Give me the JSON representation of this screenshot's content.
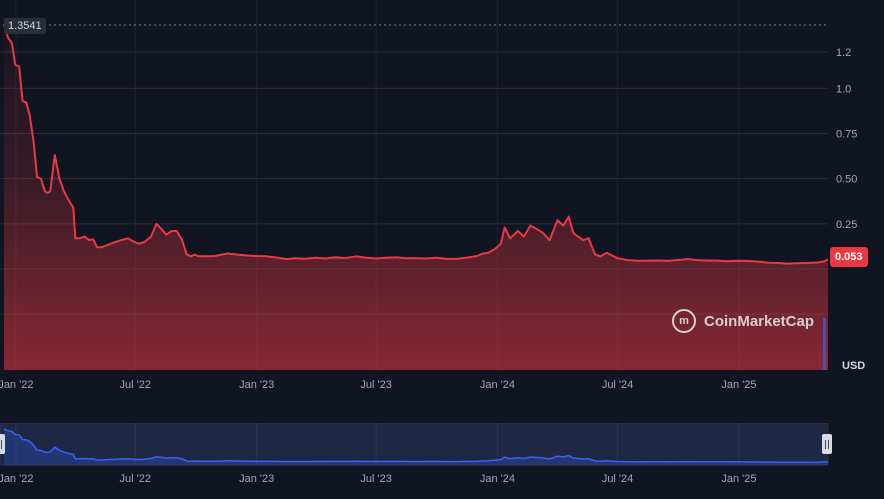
{
  "chart_data": {
    "type": "area",
    "title": "",
    "ylabel": "USD",
    "unit": "USD",
    "ylim": [
      0,
      1.35
    ],
    "y_ticks": [
      "1.2",
      "1.0",
      "0.75",
      "0.50",
      "0.25"
    ],
    "y_tick_values": [
      1.2,
      1.0,
      0.75,
      0.5,
      0.25
    ],
    "x_ticks": [
      "Jan '22",
      "Jul '22",
      "Jan '23",
      "Jul '23",
      "Jan '24",
      "Jul '24",
      "Jan '25"
    ],
    "x_tick_values": [
      "2022-01-01",
      "2022-07-01",
      "2023-01-01",
      "2023-07-01",
      "2024-01-01",
      "2024-07-01",
      "2025-01-01"
    ],
    "high_label": "1.3541",
    "current_label": "0.053",
    "line_color": "#ea3943",
    "navigator_color": "#3861fb",
    "series": [
      {
        "x": [
          "2021-12-14",
          "2021-12-20",
          "2021-12-26",
          "2021-12-31",
          "2022-01-06",
          "2022-01-11",
          "2022-01-17",
          "2022-01-22",
          "2022-01-28",
          "2022-02-02",
          "2022-02-08",
          "2022-02-14",
          "2022-02-18",
          "2022-02-22",
          "2022-03-01",
          "2022-03-08",
          "2022-03-15",
          "2022-03-22",
          "2022-03-29",
          "2022-04-01",
          "2022-04-08",
          "2022-04-15",
          "2022-04-22",
          "2022-04-28",
          "2022-05-04",
          "2022-05-11",
          "2022-05-18",
          "2022-05-25",
          "2022-06-01",
          "2022-06-10",
          "2022-06-20",
          "2022-06-29",
          "2022-07-07",
          "2022-07-15",
          "2022-07-25",
          "2022-08-02",
          "2022-08-10",
          "2022-08-17",
          "2022-08-25",
          "2022-09-02",
          "2022-09-10",
          "2022-09-17",
          "2022-09-24",
          "2022-09-29",
          "2022-10-05",
          "2022-10-13",
          "2022-10-21",
          "2022-10-29",
          "2022-11-04",
          "2022-11-10",
          "2022-11-18",
          "2022-12-01",
          "2022-12-15",
          "2022-12-31",
          "2023-01-15",
          "2023-02-01",
          "2023-02-15",
          "2023-03-01",
          "2023-03-15",
          "2023-04-01",
          "2023-04-15",
          "2023-05-01",
          "2023-05-15",
          "2023-06-01",
          "2023-06-15",
          "2023-07-01",
          "2023-07-15",
          "2023-08-01",
          "2023-08-15",
          "2023-09-01",
          "2023-09-15",
          "2023-10-01",
          "2023-10-15",
          "2023-11-01",
          "2023-11-15",
          "2023-12-01",
          "2023-12-10",
          "2023-12-18",
          "2023-12-28",
          "2024-01-06",
          "2024-01-12",
          "2024-01-20",
          "2024-02-01",
          "2024-02-10",
          "2024-02-20",
          "2024-03-01",
          "2024-03-10",
          "2024-03-20",
          "2024-04-01",
          "2024-04-10",
          "2024-04-18",
          "2024-04-25",
          "2024-05-02",
          "2024-05-10",
          "2024-05-18",
          "2024-05-28",
          "2024-06-05",
          "2024-06-15",
          "2024-06-25",
          "2024-07-01",
          "2024-07-15",
          "2024-08-01",
          "2024-08-15",
          "2024-09-01",
          "2024-09-15",
          "2024-10-01",
          "2024-10-15",
          "2024-11-01",
          "2024-11-15",
          "2024-12-01",
          "2024-12-15",
          "2025-01-01",
          "2025-01-15",
          "2025-02-01",
          "2025-02-15",
          "2025-03-01",
          "2025-03-15",
          "2025-04-01",
          "2025-04-15",
          "2025-05-01",
          "2025-05-10",
          "2025-05-16"
        ],
        "values": [
          1.3541,
          1.28,
          1.25,
          1.13,
          1.12,
          0.93,
          0.92,
          0.85,
          0.7,
          0.51,
          0.5,
          0.43,
          0.42,
          0.43,
          0.63,
          0.5,
          0.43,
          0.38,
          0.34,
          0.17,
          0.17,
          0.18,
          0.16,
          0.165,
          0.12,
          0.12,
          0.13,
          0.14,
          0.15,
          0.16,
          0.17,
          0.15,
          0.14,
          0.15,
          0.18,
          0.25,
          0.22,
          0.19,
          0.21,
          0.21,
          0.16,
          0.08,
          0.07,
          0.08,
          0.07,
          0.07,
          0.07,
          0.072,
          0.076,
          0.08,
          0.086,
          0.08,
          0.075,
          0.072,
          0.07,
          0.063,
          0.055,
          0.06,
          0.057,
          0.062,
          0.058,
          0.065,
          0.06,
          0.07,
          0.063,
          0.058,
          0.062,
          0.064,
          0.06,
          0.06,
          0.058,
          0.062,
          0.056,
          0.057,
          0.062,
          0.072,
          0.085,
          0.09,
          0.11,
          0.14,
          0.23,
          0.17,
          0.21,
          0.18,
          0.24,
          0.22,
          0.2,
          0.16,
          0.27,
          0.24,
          0.29,
          0.2,
          0.18,
          0.16,
          0.17,
          0.08,
          0.07,
          0.09,
          0.07,
          0.06,
          0.05,
          0.045,
          0.046,
          0.047,
          0.045,
          0.05,
          0.055,
          0.048,
          0.047,
          0.046,
          0.043,
          0.046,
          0.044,
          0.04,
          0.035,
          0.033,
          0.03,
          0.032,
          0.033,
          0.036,
          0.042,
          0.053
        ]
      }
    ]
  },
  "watermark": {
    "brand": "CoinMarketCap",
    "logo_glyph": "m"
  }
}
